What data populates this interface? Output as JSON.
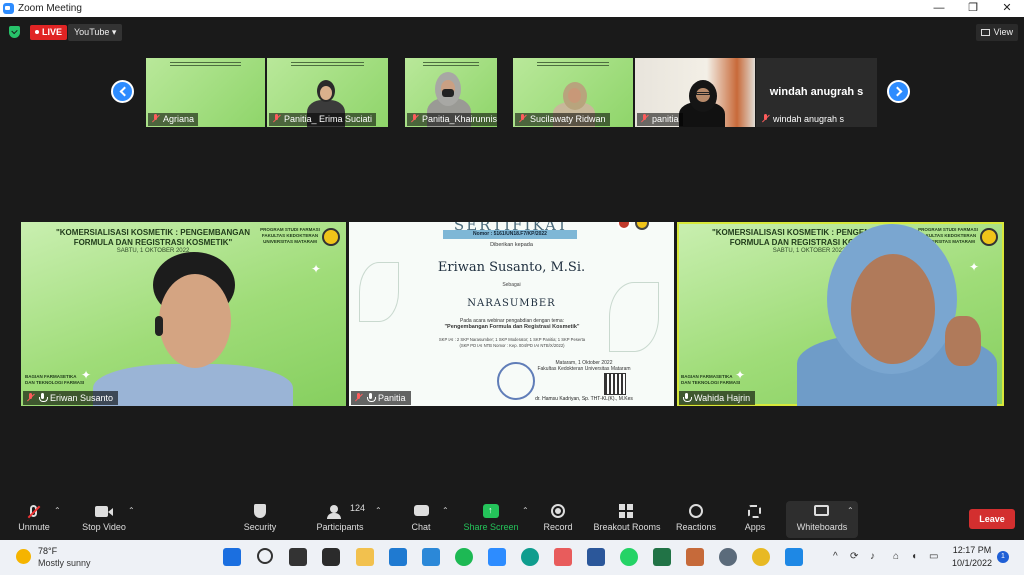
{
  "window": {
    "title": "Zoom Meeting",
    "controls": {
      "minimize": "—",
      "maximize": "❐",
      "close": "✕"
    }
  },
  "top": {
    "live_label": "LIVE",
    "youtube_label": "YouTube ▾",
    "view_label": "View"
  },
  "thumbnails": [
    {
      "name": "Agriana",
      "muted": true
    },
    {
      "name": "Panitia_ Erima Suciati",
      "muted": true
    },
    {
      "name": "Panitia_Khairunnisa",
      "muted": true
    },
    {
      "name": "Sucilawaty Ridwan",
      "muted": true
    },
    {
      "name": "panitia",
      "muted": true
    },
    {
      "name": "windah anugrah s",
      "muted": true,
      "big_name": "windah anugrah s"
    }
  ],
  "tiles": {
    "left": {
      "name": "Eriwan Susanto",
      "slide_title": "\"KOMERSIALISASI KOSMETIK : PENGEMBANGAN FORMULA DAN REGISTRASI KOSMETIK\"",
      "slide_date": "SABTU, 1 OKTOBER 2022",
      "program": "PROGRAM STUDI FARMASI FAKULTAS KEDOKTERAN UNIVERSITAS MATARAM",
      "bagian": "BAGIAN FARMASETIKA DAN TEKNOLOGI FARMASI"
    },
    "center": {
      "name": "Panitia",
      "cert_title": "SERTIFIKAT",
      "cert_number": "Nomor : 5161/UN18.F7/KP/2022",
      "given_to": "Diberikan kepada",
      "recipient": "Eriwan Susanto, M.Si.",
      "as_label": "Sebagai",
      "role": "NARASUMBER",
      "body_line1": "Pada acara webinar pengabdian dengan tema:",
      "body_theme": "\"Pengembangan Formula dan Registrasi Kosmetik\"",
      "skp_line1": "SKP IAI : 2 SKP Narasumber; 1 SKP Moderator; 1 SKP Panitia; 1 SKP Peserta",
      "skp_line2": "(SKP PD IAI NTB Nomor : Kep. 004/PD IAI NTB/X/2022)",
      "place_date": "Mataram, 1 Oktober 2022",
      "faculty": "Fakultas Kedokteran Universitas Mataram",
      "signer": "dr. Hamsu Kadriyan, Sp. THT-KL(K)., M.Kes"
    },
    "right": {
      "name": "Wahida Hajrin",
      "slide_title": "\"KOMERSIALISASI KOSMETIK : PENGEMBANGAN FORMULA DAN REGISTRASI KOSMETIK\"",
      "slide_date": "SABTU, 1 OKTOBER 2022",
      "program": "PROGRAM STUDI FARMASI FAKULTAS KEDOKTERAN UNIVERSITAS MATARAM",
      "bagian": "BAGIAN FARMASETIKA DAN TEKNOLOGI FARMASI"
    }
  },
  "toolbar": {
    "unmute": "Unmute",
    "stop_video": "Stop Video",
    "security": "Security",
    "participants": "Participants",
    "participant_count": "124",
    "chat": "Chat",
    "share_screen": "Share Screen",
    "record": "Record",
    "breakout": "Breakout Rooms",
    "reactions": "Reactions",
    "apps": "Apps",
    "whiteboards": "Whiteboards",
    "leave": "Leave"
  },
  "taskbar": {
    "temp": "78°F",
    "condition": "Mostly sunny",
    "time": "12:17 PM",
    "date": "10/1/2022",
    "notifications": "1"
  },
  "colors": {
    "accent": "#2d8cff",
    "live": "#e02424",
    "leave": "#d32f2f",
    "share": "#24c35a",
    "active_speaker": "#d7e83a"
  }
}
